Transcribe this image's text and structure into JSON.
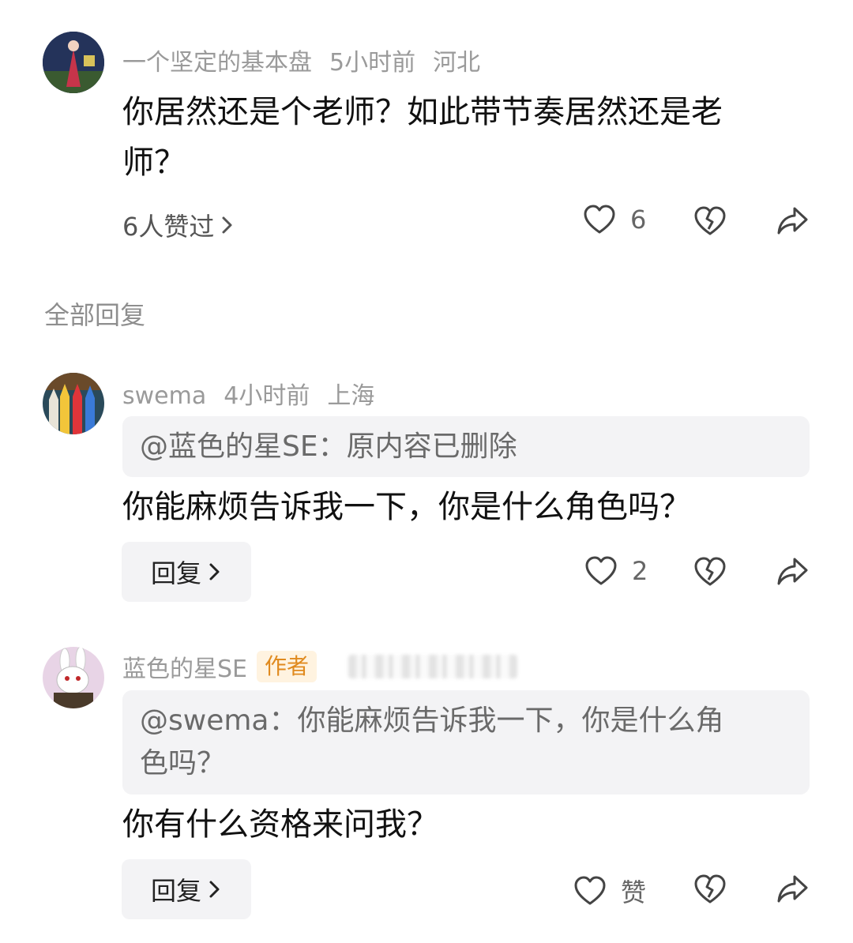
{
  "main_comment": {
    "username": "一个坚定的基本盘",
    "time": "5小时前",
    "location": "河北",
    "text_line1": "你居然还是个老师？如此带节奏居然还是老",
    "text_line2": "师？",
    "liked_by": "6人赞过",
    "like_count": "6"
  },
  "section_label": "全部回复",
  "replies": [
    {
      "username": "swema",
      "time": "4小时前",
      "location": "上海",
      "quote": "@蓝色的星SE：原内容已删除",
      "text": "你能麻烦告诉我一下，你是什么角色吗？",
      "reply_label": "回复",
      "like_count": "2"
    },
    {
      "username": "蓝色的星SE",
      "author_tag": "作者",
      "quote_line1": "@swema：你能麻烦告诉我一下，你是什么角",
      "quote_line2": "色吗？",
      "text": "你有什么资格来问我？",
      "reply_label": "回复",
      "like_label": "赞"
    }
  ],
  "icons": [
    "heart-icon",
    "dislike-heart-icon",
    "share-icon",
    "chevron-right-icon"
  ],
  "colors": {
    "meta_gray": "#9a9a9a",
    "box_bg": "#f3f3f5",
    "author_tag": "#e08a1e"
  }
}
